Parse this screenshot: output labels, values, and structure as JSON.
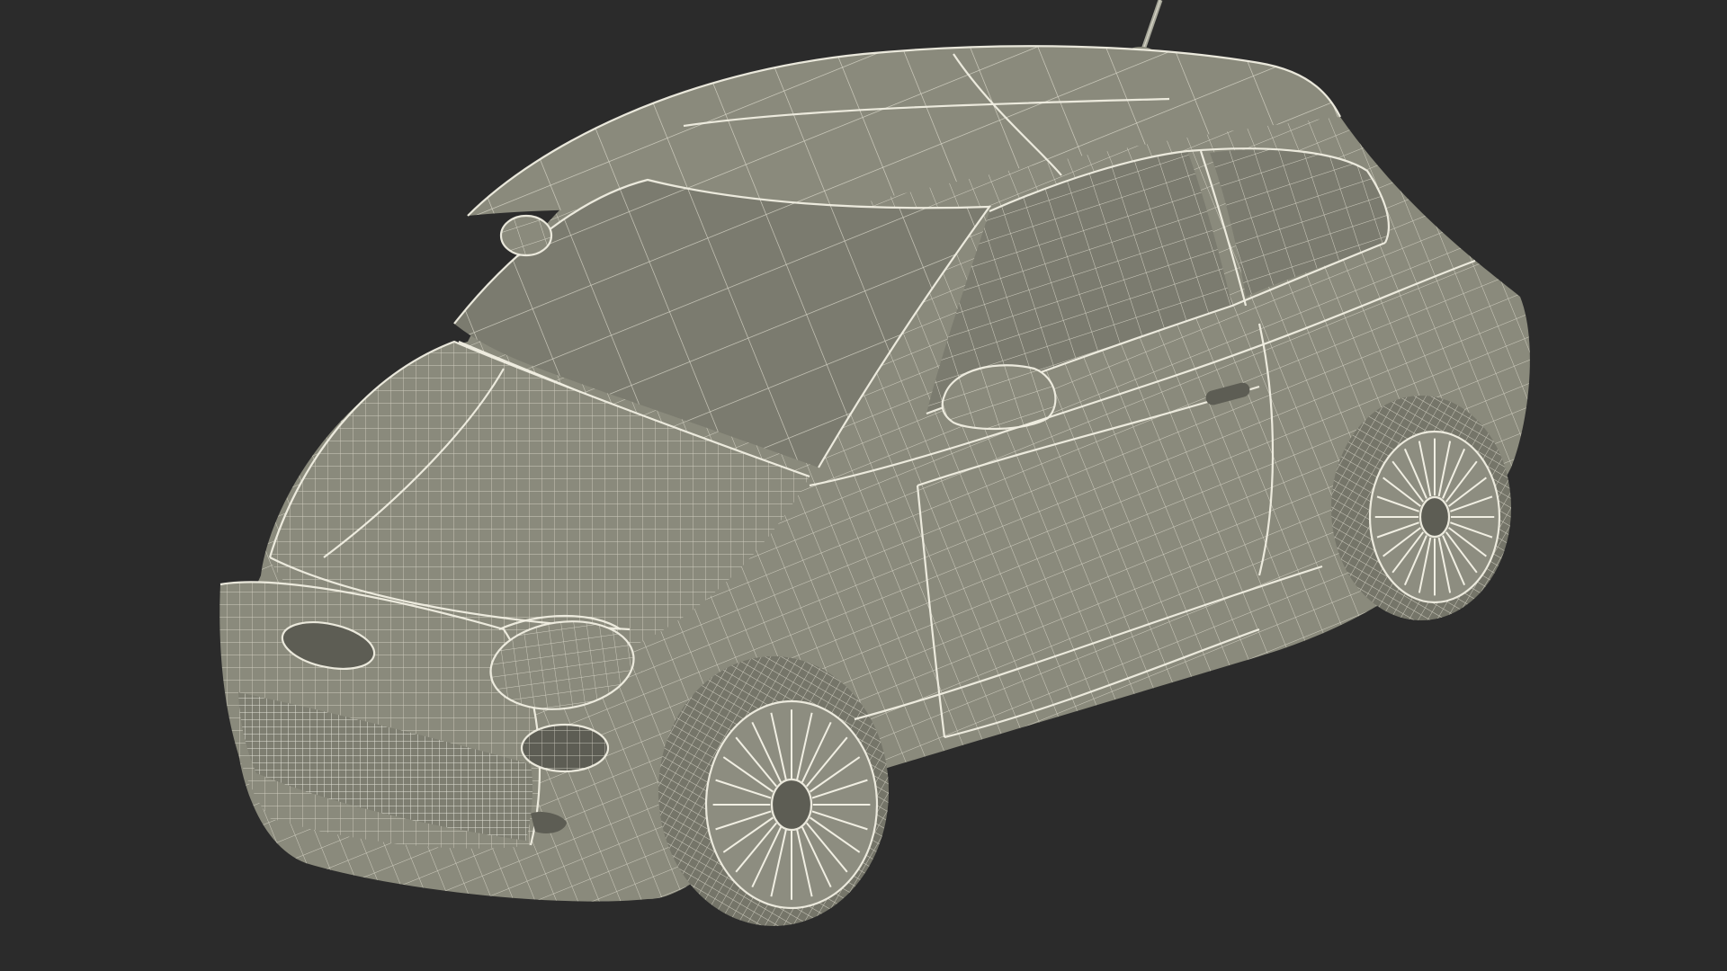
{
  "scene": {
    "background_color": "#2b2b2b",
    "model_color": "#8a8a7c",
    "wire_color": "#e6e4d6"
  },
  "badge": {
    "text": ""
  }
}
